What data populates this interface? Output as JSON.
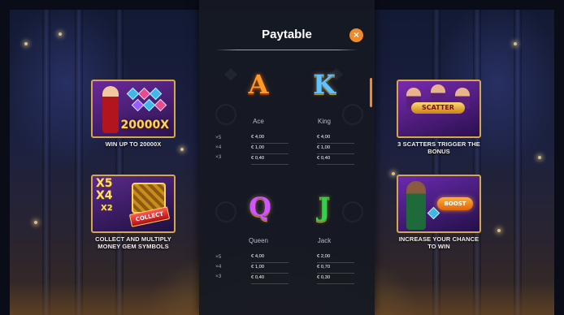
{
  "paytable": {
    "title": "Paytable",
    "close_label": "×"
  },
  "features": [
    {
      "caption": "WIN UP TO 20000X",
      "art_text": "20000X"
    },
    {
      "caption": "3 SCATTERS TRIGGER THE BONUS",
      "art_text": "SCATTER"
    },
    {
      "caption": "COLLECT AND MULTIPLY MONEY GEM SYMBOLS",
      "art_text": [
        "X5",
        "X4",
        "X2"
      ],
      "badge": "COLLECT"
    },
    {
      "caption": "INCREASE YOUR CHANCE TO WIN",
      "art_text": "BOOST"
    }
  ],
  "multipliers": [
    "×5",
    "×4",
    "×3"
  ],
  "symbols": [
    {
      "glyph": "A",
      "name": "Ace",
      "payouts": [
        "€ 4,00",
        "€ 1,00",
        "€ 0,40"
      ]
    },
    {
      "glyph": "K",
      "name": "King",
      "payouts": [
        "€ 4,00",
        "€ 1,00",
        "€ 0,40"
      ]
    },
    {
      "glyph": "Q",
      "name": "Queen",
      "payouts": [
        "€ 4,00",
        "€ 1,00",
        "€ 0,40"
      ]
    },
    {
      "glyph": "J",
      "name": "Jack",
      "payouts": [
        "€ 2,00",
        "€ 0,70",
        "€ 0,30"
      ]
    }
  ],
  "colors": {
    "accent": "#f08a2a",
    "panel": "#16192280",
    "gold_frame": "#d4a74a",
    "ace": "#ff9a28",
    "king": "#5ec3ff",
    "queen": "#d055ff",
    "jack": "#33d04e"
  },
  "icons": {
    "close": "close-icon",
    "scroll": "scrollbar-thumb"
  }
}
